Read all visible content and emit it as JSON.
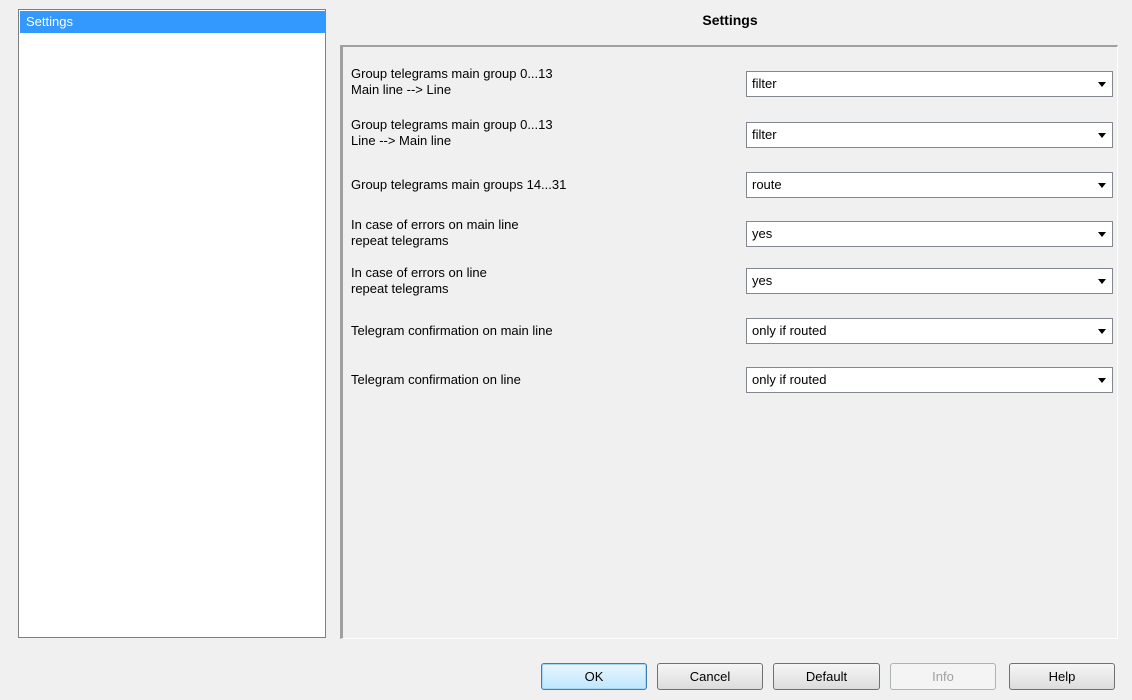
{
  "tree": {
    "items": [
      {
        "label": "Settings",
        "selected": true
      }
    ]
  },
  "page": {
    "title": "Settings"
  },
  "params": [
    {
      "label_line1": "Group telegrams main group 0...13",
      "label_line2": "Main line --> Line",
      "value": "filter"
    },
    {
      "label_line1": "Group telegrams main group 0...13",
      "label_line2": "Line --> Main line",
      "value": "filter"
    },
    {
      "label_line1": "Group telegrams main groups 14...31",
      "label_line2": "",
      "value": "route"
    },
    {
      "label_line1": "In case of errors on main line",
      "label_line2": "repeat telegrams",
      "value": "yes"
    },
    {
      "label_line1": "In case of errors on line",
      "label_line2": "repeat telegrams",
      "value": "yes"
    },
    {
      "label_line1": "Telegram confirmation on main line",
      "label_line2": "",
      "value": "only if routed"
    },
    {
      "label_line1": "Telegram confirmation on line",
      "label_line2": "",
      "value": "only if routed"
    }
  ],
  "buttons": {
    "ok": "OK",
    "cancel": "Cancel",
    "default": "Default",
    "info": "Info",
    "help": "Help"
  },
  "colors": {
    "selection": "#3399ff",
    "window_bg": "#f0f0f0"
  }
}
